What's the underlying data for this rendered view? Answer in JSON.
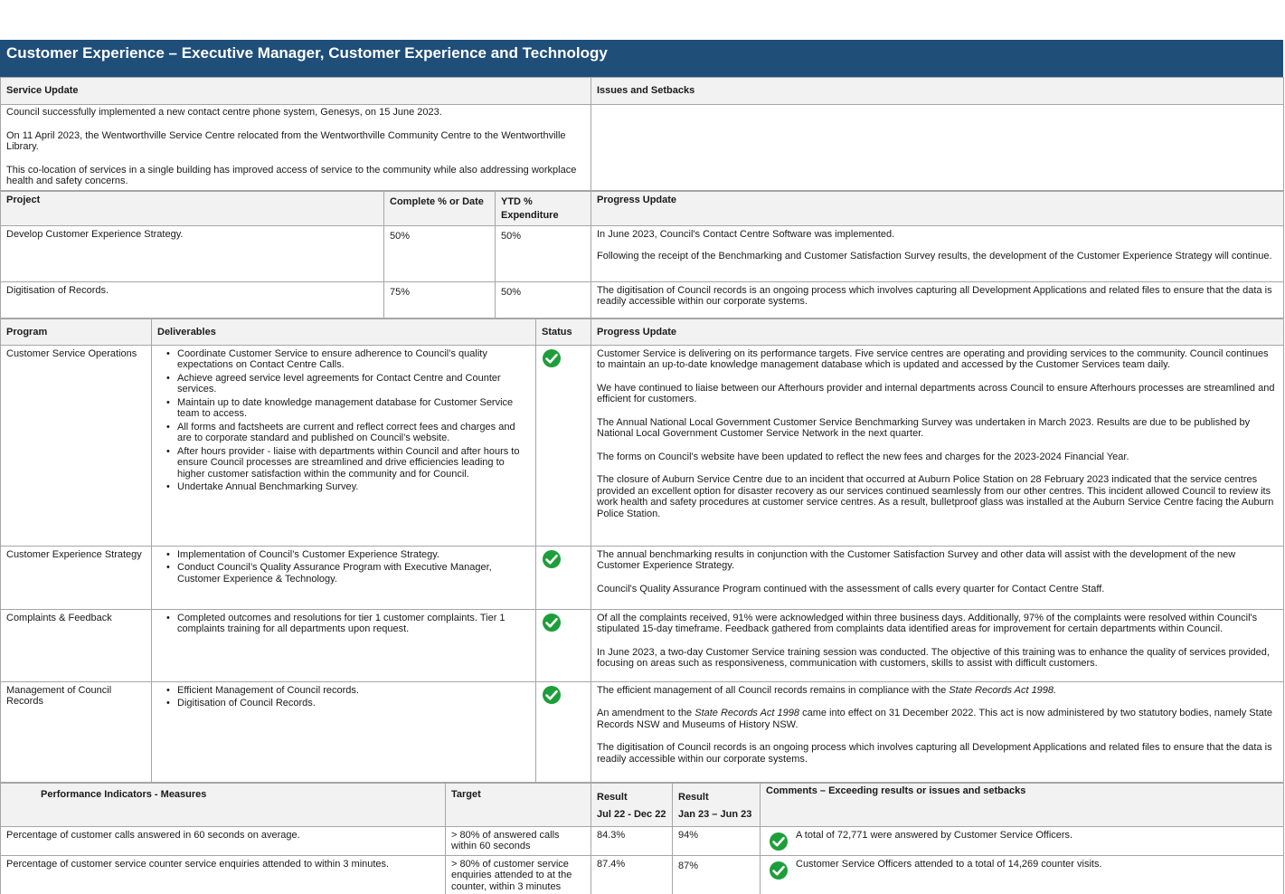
{
  "title": "Customer Experience – Executive Manager, Customer Experience and Technology",
  "service_update": {
    "heading": "Service Update",
    "paragraphs": [
      "Council successfully implemented a new contact centre phone system, Genesys, on 15 June 2023.",
      "On 11 April 2023, the Wentworthville Service Centre relocated from the Wentworthville Community Centre to the Wentworthville Library.",
      "This co-location of services in a single building has improved access of service to the community while also addressing workplace health and safety concerns."
    ]
  },
  "issues": {
    "heading": "Issues and Setbacks",
    "text": ""
  },
  "projects": {
    "headers": {
      "project": "Project",
      "complete": "Complete % or Date",
      "ytd": "YTD % Expenditure",
      "progress": "Progress Update"
    },
    "rows": [
      {
        "project": "Develop Customer Experience Strategy.",
        "complete": "50%",
        "ytd": "50%",
        "progress": [
          "In June 2023, Council's Contact Centre Software was implemented.",
          "Following the receipt of the Benchmarking and Customer Satisfaction Survey results, the development of the Customer Experience Strategy will continue."
        ]
      },
      {
        "project": "Digitisation of Records.",
        "complete": "75%",
        "ytd": "50%",
        "progress": [
          "The digitisation of Council records is an ongoing process which involves capturing all Development Applications and related files to ensure that the data is readily accessible within our corporate systems."
        ]
      }
    ]
  },
  "programs": {
    "headers": {
      "program": "Program",
      "deliverables": "Deliverables",
      "status": "Status",
      "progress": "Progress Update"
    },
    "status_icon": "check-circle-icon",
    "status_color": "#1e9e3a",
    "rows": [
      {
        "program": "Customer Service Operations",
        "deliverables": [
          "Coordinate Customer Service to ensure adherence to Council’s quality expectations on Contact Centre Calls.",
          "Achieve agreed service level agreements for Contact Centre and Counter services.",
          "Maintain up to date knowledge management database for Customer Service team to access.",
          "All forms and factsheets are current and reflect correct fees and charges and are to corporate standard and published on Council’s website.",
          "After hours provider - liaise with departments within Council and after hours to ensure Council processes are streamlined and drive efficiencies leading to higher customer satisfaction within the community and for Council.",
          "Undertake Annual Benchmarking Survey."
        ],
        "progress": [
          "Customer Service is delivering on its performance targets. Five service centres are operating and providing services to the community. Council continues to maintain an up-to-date knowledge management database which is updated and accessed by the Customer Services team daily.",
          "We have continued to liaise between our Afterhours provider and internal departments across Council to ensure Afterhours processes are streamlined and efficient for customers.",
          "The Annual National Local Government Customer Service Benchmarking Survey was undertaken in March 2023. Results are due to be published by National Local Government Customer Service Network in the next quarter.",
          "The forms on Council's website have been updated to reflect the new fees and charges for the 2023-2024 Financial Year.",
          "The closure of Auburn Service Centre due to an incident that occurred at Auburn Police Station on 28 February 2023 indicated that the service centres provided an excellent option for disaster recovery as our services continued seamlessly from our other centres. This incident allowed Council to review its work health and safety procedures at customer service centres. As a result, bulletproof glass was installed at the Auburn Service Centre facing the Auburn Police Station."
        ]
      },
      {
        "program": "Customer Experience Strategy",
        "deliverables": [
          "Implementation of Council’s Customer Experience Strategy.",
          "Conduct Council’s Quality Assurance Program with Executive Manager, Customer Experience & Technology."
        ],
        "progress": [
          "The annual benchmarking results in conjunction with the Customer Satisfaction Survey and other data will assist with the development of the new Customer Experience Strategy.",
          "Council's Quality Assurance Program continued with the assessment of calls every quarter for Contact Centre Staff."
        ]
      },
      {
        "program": "Complaints & Feedback",
        "deliverables": [
          "Completed outcomes and resolutions for tier 1 customer complaints. Tier 1 complaints training for all departments upon request."
        ],
        "progress": [
          "Of all the complaints received, 91% were acknowledged within three business days. Additionally, 97% of the complaints were resolved within Council's stipulated 15-day timeframe. Feedback gathered from complaints data identified areas for improvement for certain departments within Council.",
          "In June 2023, a two-day Customer Service training session was conducted. The objective of this training was to enhance the quality of services provided, focusing on areas such as responsiveness, communication with customers, skills to assist with difficult customers."
        ]
      },
      {
        "program": "Management of Council Records",
        "deliverables": [
          "Efficient Management of Council records.",
          "Digitisation of Council Records."
        ],
        "progress_rich": {
          "p1_pre": "The efficient management of all Council records remains in compliance with the ",
          "p1_italic": "State Records Act 1998.",
          "p2_pre": "An amendment to the ",
          "p2_italic": "State Records Act 1998",
          "p2_post": " came into effect on 31 December 2022. This act is now administered by two statutory bodies, namely State Records NSW and Museums of History NSW.",
          "p3": "The digitisation of Council records is an ongoing process which involves capturing all Development Applications and related files to ensure that the data is readily accessible within our corporate systems."
        }
      }
    ]
  },
  "performance": {
    "headers": {
      "measure": "Performance Indicators - Measures",
      "target": "Target",
      "result1_label": "Result",
      "result1_period": "Jul 22 - Dec 22",
      "result2_label": "Result",
      "result2_period": "Jan 23 – Jun 23",
      "comments": "Comments – Exceeding results or issues and setbacks"
    },
    "rows": [
      {
        "measure": "Percentage of customer calls answered in 60 seconds on average.",
        "target": "> 80% of answered calls within 60 seconds",
        "result1": "84.3%",
        "result2": "94%",
        "comment": "A total of 72,771 were answered by Customer Service Officers."
      },
      {
        "measure": "Percentage of customer service counter service enquiries attended to within 3 minutes.",
        "target": "> 80% of customer service enquiries attended to at the counter, within 3 minutes",
        "result1": "87.4%",
        "result2": "87%",
        "comment": "Customer Service Officers attended to a total of 14,269 counter visits."
      }
    ]
  }
}
